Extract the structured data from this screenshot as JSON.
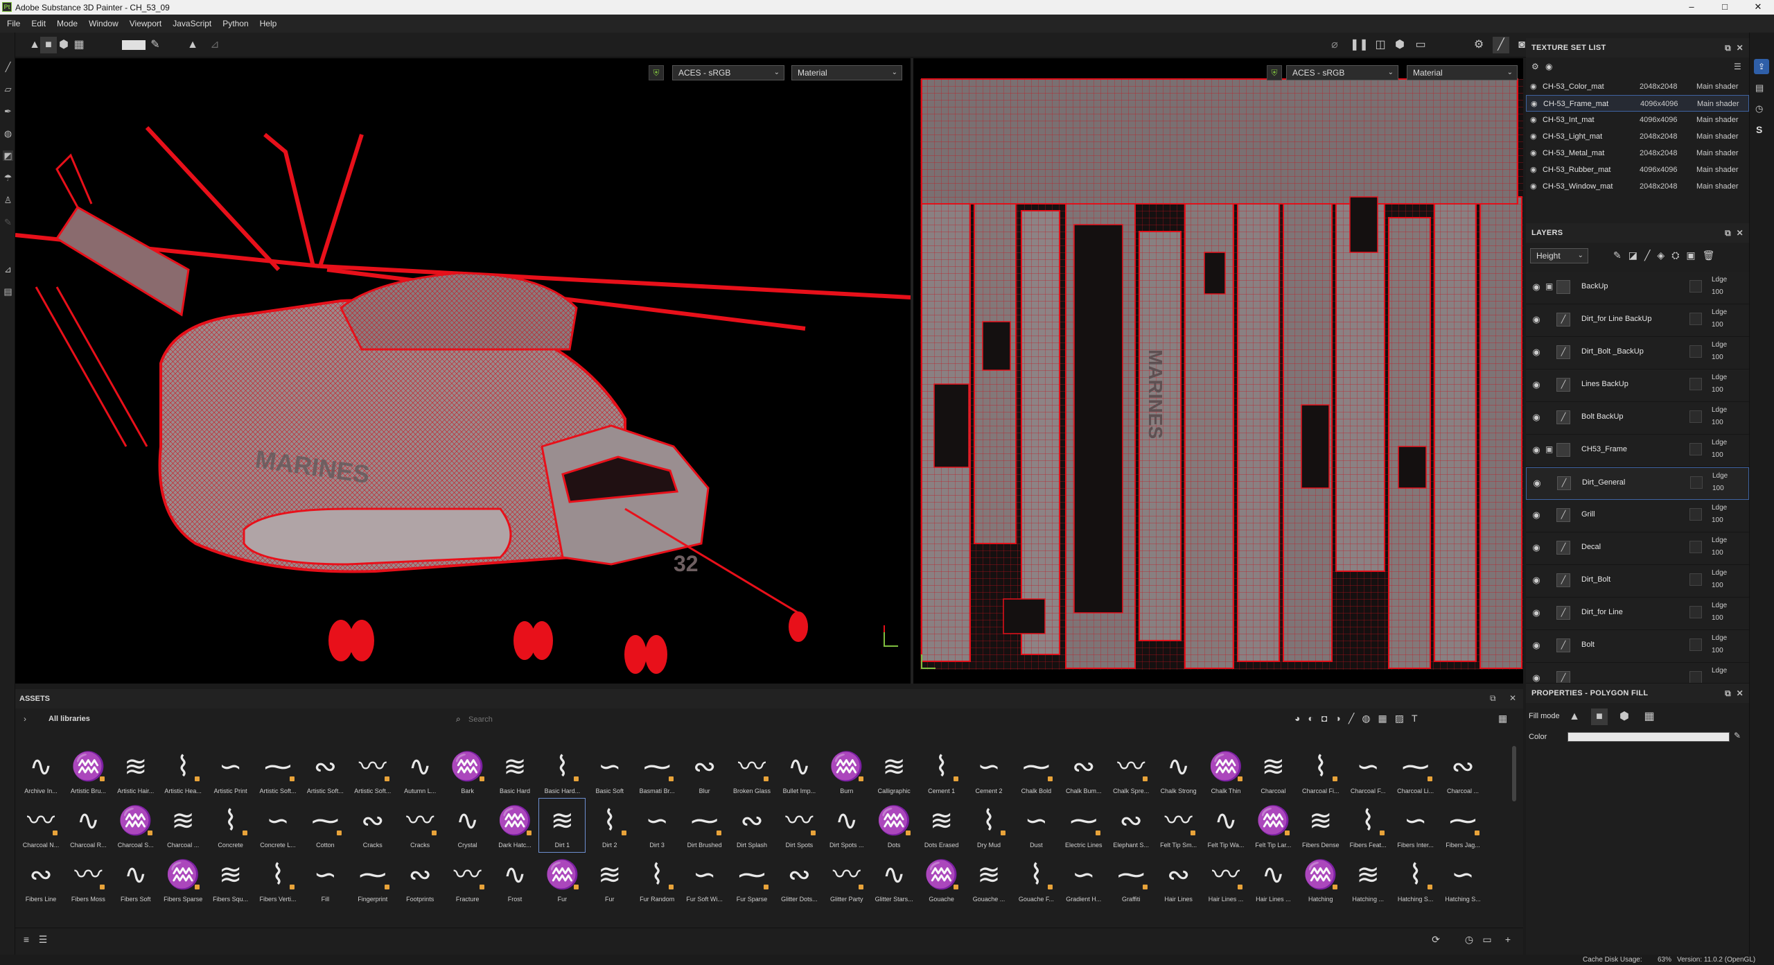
{
  "window": {
    "title": "Adobe Substance 3D Painter - CH_53_09",
    "logo_text": "Pt",
    "minimize": "–",
    "maximize": "□",
    "close": "✕"
  },
  "menu": [
    "File",
    "Edit",
    "Mode",
    "Window",
    "Viewport",
    "JavaScript",
    "Python",
    "Help"
  ],
  "viewport3d": {
    "colorspace": "ACES - sRGB",
    "channel": "Material",
    "text_marines": "MARINES",
    "text_number": "32"
  },
  "viewport2d": {
    "colorspace": "ACES - sRGB",
    "channel": "Material",
    "text_marines": "MARINES"
  },
  "texture_set_list": {
    "title": "TEXTURE SET LIST",
    "items": [
      {
        "name": "CH-53_Color_mat",
        "res": "2048x2048",
        "shader": "Main shader"
      },
      {
        "name": "CH-53_Frame_mat",
        "res": "4096x4096",
        "shader": "Main shader",
        "selected": true
      },
      {
        "name": "CH-53_Int_mat",
        "res": "4096x4096",
        "shader": "Main shader"
      },
      {
        "name": "CH-53_Light_mat",
        "res": "2048x2048",
        "shader": "Main shader"
      },
      {
        "name": "CH-53_Metal_mat",
        "res": "2048x2048",
        "shader": "Main shader"
      },
      {
        "name": "CH-53_Rubber_mat",
        "res": "4096x4096",
        "shader": "Main shader"
      },
      {
        "name": "CH-53_Window_mat",
        "res": "2048x2048",
        "shader": "Main shader"
      }
    ]
  },
  "layers": {
    "title": "LAYERS",
    "channel": "Height",
    "items": [
      {
        "name": "BackUp",
        "type": "folder",
        "blend": "Ldge",
        "opacity": "100"
      },
      {
        "name": "Dirt_for Line BackUp",
        "type": "paint",
        "blend": "Ldge",
        "opacity": "100"
      },
      {
        "name": "Dirt_Bolt _BackUp",
        "type": "paint",
        "blend": "Ldge",
        "opacity": "100"
      },
      {
        "name": "Lines BackUp",
        "type": "paint",
        "blend": "Ldge",
        "opacity": "100"
      },
      {
        "name": "Bolt BackUp",
        "type": "paint",
        "blend": "Ldge",
        "opacity": "100"
      },
      {
        "name": "CH53_Frame",
        "type": "folder",
        "blend": "Ldge",
        "opacity": "100"
      },
      {
        "name": "Dirt_General",
        "type": "paint",
        "blend": "Ldge",
        "opacity": "100",
        "selected": true
      },
      {
        "name": "Grill",
        "type": "paint",
        "blend": "Ldge",
        "opacity": "100"
      },
      {
        "name": "Decal",
        "type": "paint",
        "blend": "Ldge",
        "opacity": "100"
      },
      {
        "name": "Dirt_Bolt",
        "type": "paint",
        "blend": "Ldge",
        "opacity": "100"
      },
      {
        "name": "Dirt_for Line",
        "type": "paint",
        "blend": "Ldge",
        "opacity": "100"
      },
      {
        "name": "Bolt",
        "type": "paint",
        "blend": "Ldge",
        "opacity": "100"
      },
      {
        "name": "",
        "type": "paint",
        "blend": "Ldge",
        "opacity": ""
      }
    ]
  },
  "properties": {
    "title": "PROPERTIES - POLYGON FILL",
    "fill_mode_label": "Fill mode",
    "color_label": "Color",
    "color_value": "#e8e8e8"
  },
  "assets": {
    "title": "ASSETS",
    "library": "All libraries",
    "search_placeholder": "Search",
    "rows": [
      [
        "Archive In...",
        "Artistic Bru...",
        "Artistic Hair...",
        "Artistic Hea...",
        "Artistic Print",
        "Artistic Soft...",
        "Artistic Soft...",
        "Artistic Soft...",
        "Autumn L...",
        "Bark",
        "Basic Hard",
        "Basic Hard...",
        "Basic Soft",
        "Basmati Br...",
        "Blur",
        "Broken Glass",
        "Bullet Imp...",
        "Burn",
        "Calligraphic",
        "Cement 1",
        "Cement 2",
        "Chalk Bold",
        "Chalk Bum...",
        "Chalk Spre...",
        "Chalk Strong",
        "Chalk Thin",
        "Charcoal",
        "Charcoal Fi...",
        "Charcoal F...",
        "Charcoal Li...",
        "Charcoal ..."
      ],
      [
        "Charcoal N...",
        "Charcoal R...",
        "Charcoal S...",
        "Charcoal ...",
        "Concrete",
        "Concrete L...",
        "Cotton",
        "Cracks",
        "Cracks",
        "Crystal",
        "Dark Hatc...",
        "Dirt 1",
        "Dirt 2",
        "Dirt 3",
        "Dirt Brushed",
        "Dirt Splash",
        "Dirt Spots",
        "Dirt Spots ...",
        "Dots",
        "Dots Erased",
        "Dry Mud",
        "Dust",
        "Electric Lines",
        "Elephant S...",
        "Felt Tip Sm...",
        "Felt Tip Wa...",
        "Felt Tip Lar...",
        "Fibers Dense",
        "Fibers Feat...",
        "Fibers Inter...",
        "Fibers Jag..."
      ],
      [
        "Fibers Line",
        "Fibers Moss",
        "Fibers Soft",
        "Fibers Sparse",
        "Fibers Squ...",
        "Fibers Verti...",
        "Fill",
        "Fingerprint",
        "Footprints",
        "Fracture",
        "Frost",
        "Fur",
        "Fur",
        "Fur Random",
        "Fur Soft Wi...",
        "Fur Sparse",
        "Glitter Dots...",
        "Glitter Party",
        "Glitter Stars...",
        "Gouache",
        "Gouache ...",
        "Gouache F...",
        "Gradient H...",
        "Graffiti",
        "Hair Lines",
        "Hair Lines ...",
        "Hair Lines ...",
        "Hatching",
        "Hatching ...",
        "Hatching S...",
        "Hatching S..."
      ]
    ],
    "selected": "Dirt 1"
  },
  "status": {
    "cache": "Cache Disk Usage:",
    "cache_value": "63%",
    "version": "Version: 11.0.2 (OpenGL)"
  },
  "colors": {
    "wire": "#e8101a",
    "accent": "#3f63a0",
    "orange": "#e8a33a"
  }
}
